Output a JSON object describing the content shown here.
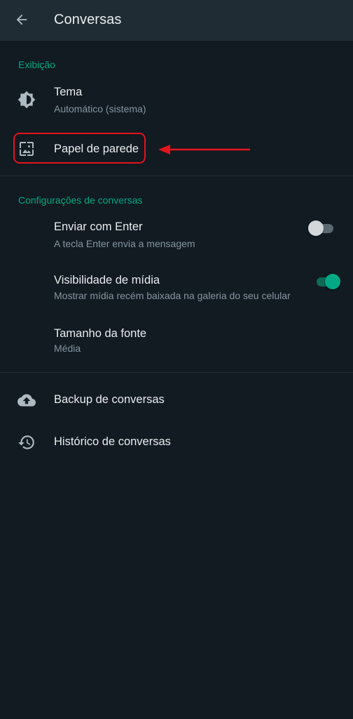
{
  "header": {
    "title": "Conversas",
    "back_icon": "arrow-back-icon"
  },
  "sections": {
    "display": {
      "title": "Exibição",
      "theme": {
        "label": "Tema",
        "value": "Automático (sistema)",
        "icon": "brightness-icon"
      },
      "wallpaper": {
        "label": "Papel de parede",
        "icon": "wallpaper-icon",
        "highlighted": true
      }
    },
    "chat_settings": {
      "title": "Configurações de conversas",
      "enter_send": {
        "label": "Enviar com Enter",
        "description": "A tecla Enter envia a mensagem",
        "enabled": false
      },
      "media_visibility": {
        "label": "Visibilidade de mídia",
        "description": "Mostrar mídia recém baixada na galeria do seu celular",
        "enabled": true
      },
      "font_size": {
        "label": "Tamanho da fonte",
        "value": "Média"
      }
    },
    "other": {
      "backup": {
        "label": "Backup de conversas",
        "icon": "cloud-upload-icon"
      },
      "history": {
        "label": "Histórico de conversas",
        "icon": "history-icon"
      }
    }
  },
  "colors": {
    "background": "#111b21",
    "appbar": "#202c33",
    "accent": "#00a884",
    "annotation": "#e3141b"
  }
}
